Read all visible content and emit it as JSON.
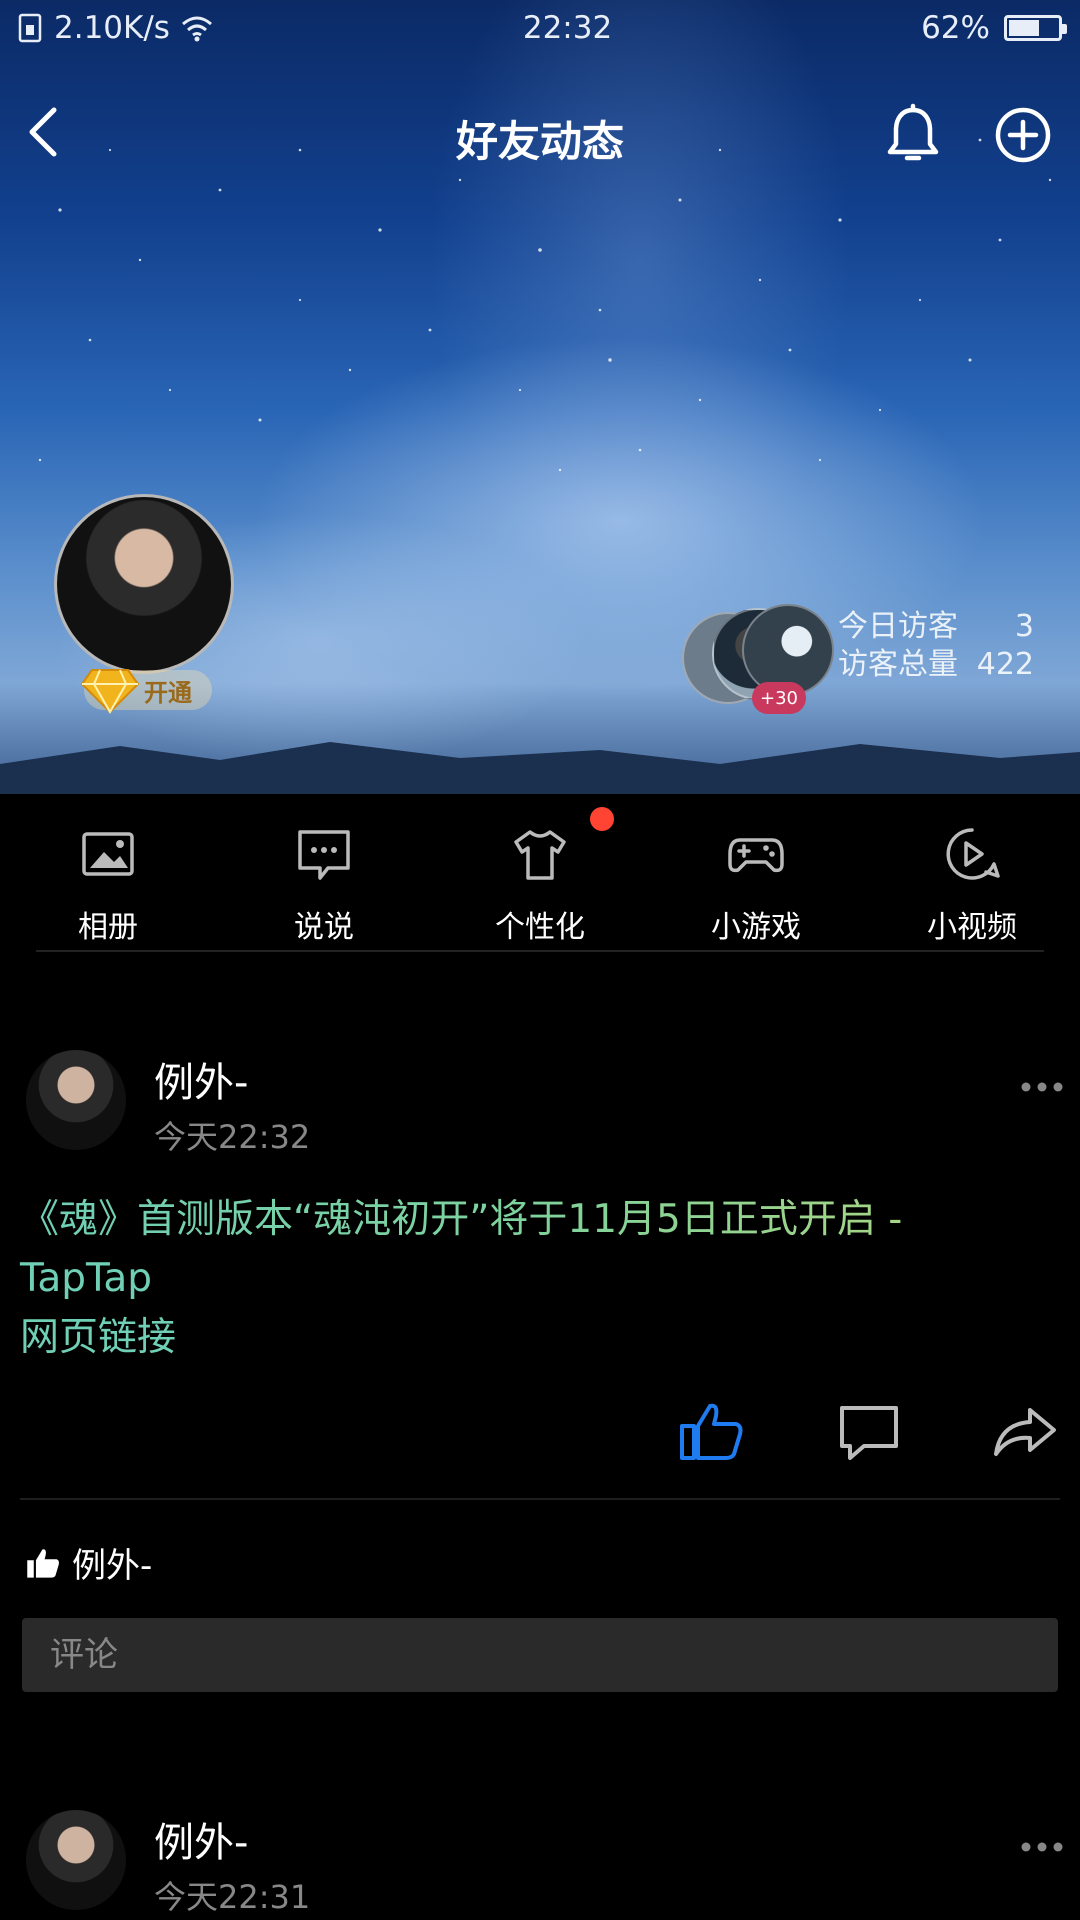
{
  "status_bar": {
    "network_speed": "2.10K/s",
    "time": "22:32",
    "battery_percent": "62%",
    "battery_level": 0.62
  },
  "header": {
    "title": "好友动态",
    "icons": [
      "back-arrow-icon",
      "bell-icon",
      "plus-circle-icon"
    ]
  },
  "profile": {
    "vip_label": "开通",
    "visitor_badge": "+30",
    "today_visitors_label": "今日访客",
    "today_visitors_value": "3",
    "total_visitors_label": "访客总量",
    "total_visitors_value": "422"
  },
  "nav": {
    "items": [
      {
        "label": "相册",
        "icon": "photo-album-icon"
      },
      {
        "label": "说说",
        "icon": "message-bubble-icon"
      },
      {
        "label": "个性化",
        "icon": "tshirt-icon"
      },
      {
        "label": "小游戏",
        "icon": "gamepad-icon"
      },
      {
        "label": "小视频",
        "icon": "video-play-icon"
      }
    ],
    "badge_color": "#ff4433"
  },
  "feed": [
    {
      "author": "例外-",
      "time": "今天22:32",
      "content_line1": "《魂》首测版本“魂沌初开”将于11月5日正式开启 -",
      "content_line2": "TapTap",
      "link_label": "网页链接",
      "liked": true,
      "like_color": "#1f7cf0",
      "likers": "例外-",
      "comment_placeholder": "评论"
    },
    {
      "author": "例外-",
      "time": "今天22:31"
    }
  ]
}
